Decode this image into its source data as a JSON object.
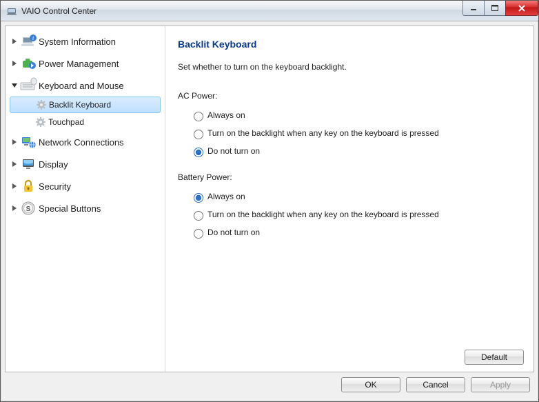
{
  "window": {
    "title": "VAIO Control Center"
  },
  "nav": {
    "items": [
      {
        "label": "System Information",
        "expanded": false
      },
      {
        "label": "Power Management",
        "expanded": false
      },
      {
        "label": "Keyboard and Mouse",
        "expanded": true,
        "children": [
          {
            "label": "Backlit Keyboard",
            "selected": true
          },
          {
            "label": "Touchpad",
            "selected": false
          }
        ]
      },
      {
        "label": "Network Connections",
        "expanded": false
      },
      {
        "label": "Display",
        "expanded": false
      },
      {
        "label": "Security",
        "expanded": false
      },
      {
        "label": "Special Buttons",
        "expanded": false
      }
    ]
  },
  "content": {
    "title": "Backlit Keyboard",
    "description": "Set whether to turn on the keyboard backlight.",
    "ac": {
      "label": "AC Power:",
      "options": {
        "always": "Always on",
        "onkey": "Turn on the backlight when any key on the keyboard is pressed",
        "never": "Do not turn on"
      },
      "selected": "never"
    },
    "battery": {
      "label": "Battery Power:",
      "options": {
        "always": "Always on",
        "onkey": "Turn on the backlight when any key on the keyboard is pressed",
        "never": "Do not turn on"
      },
      "selected": "always"
    },
    "default_button": "Default"
  },
  "footer": {
    "ok": "OK",
    "cancel": "Cancel",
    "apply": "Apply"
  }
}
